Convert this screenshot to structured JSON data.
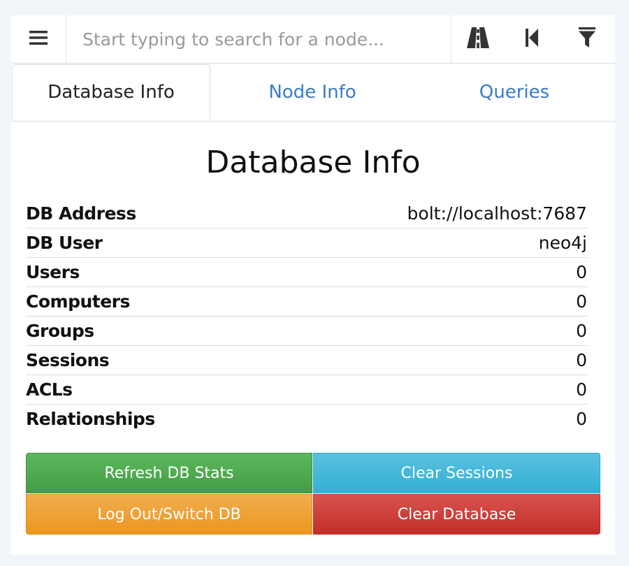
{
  "search": {
    "placeholder": "Start typing to search for a node..."
  },
  "toolbar": {
    "icons": [
      "menu-icon",
      "pathfinding-icon",
      "back-icon",
      "filter-icon"
    ]
  },
  "tabs": [
    {
      "label": "Database Info",
      "active": true
    },
    {
      "label": "Node Info",
      "active": false
    },
    {
      "label": "Queries",
      "active": false
    }
  ],
  "main": {
    "title": "Database Info",
    "rows": [
      {
        "label": "DB Address",
        "value": "bolt://localhost:7687"
      },
      {
        "label": "DB User",
        "value": "neo4j"
      },
      {
        "label": "Users",
        "value": "0"
      },
      {
        "label": "Computers",
        "value": "0"
      },
      {
        "label": "Groups",
        "value": "0"
      },
      {
        "label": "Sessions",
        "value": "0"
      },
      {
        "label": "ACLs",
        "value": "0"
      },
      {
        "label": "Relationships",
        "value": "0"
      }
    ]
  },
  "buttons": {
    "refresh": "Refresh DB Stats",
    "clear_sessions": "Clear Sessions",
    "logout": "Log Out/Switch DB",
    "clear_database": "Clear Database"
  },
  "colors": {
    "link": "#3b7cc4",
    "success": "#5cb85c",
    "info": "#5bc0de",
    "warning": "#f0ad4e",
    "danger": "#d9534f"
  }
}
